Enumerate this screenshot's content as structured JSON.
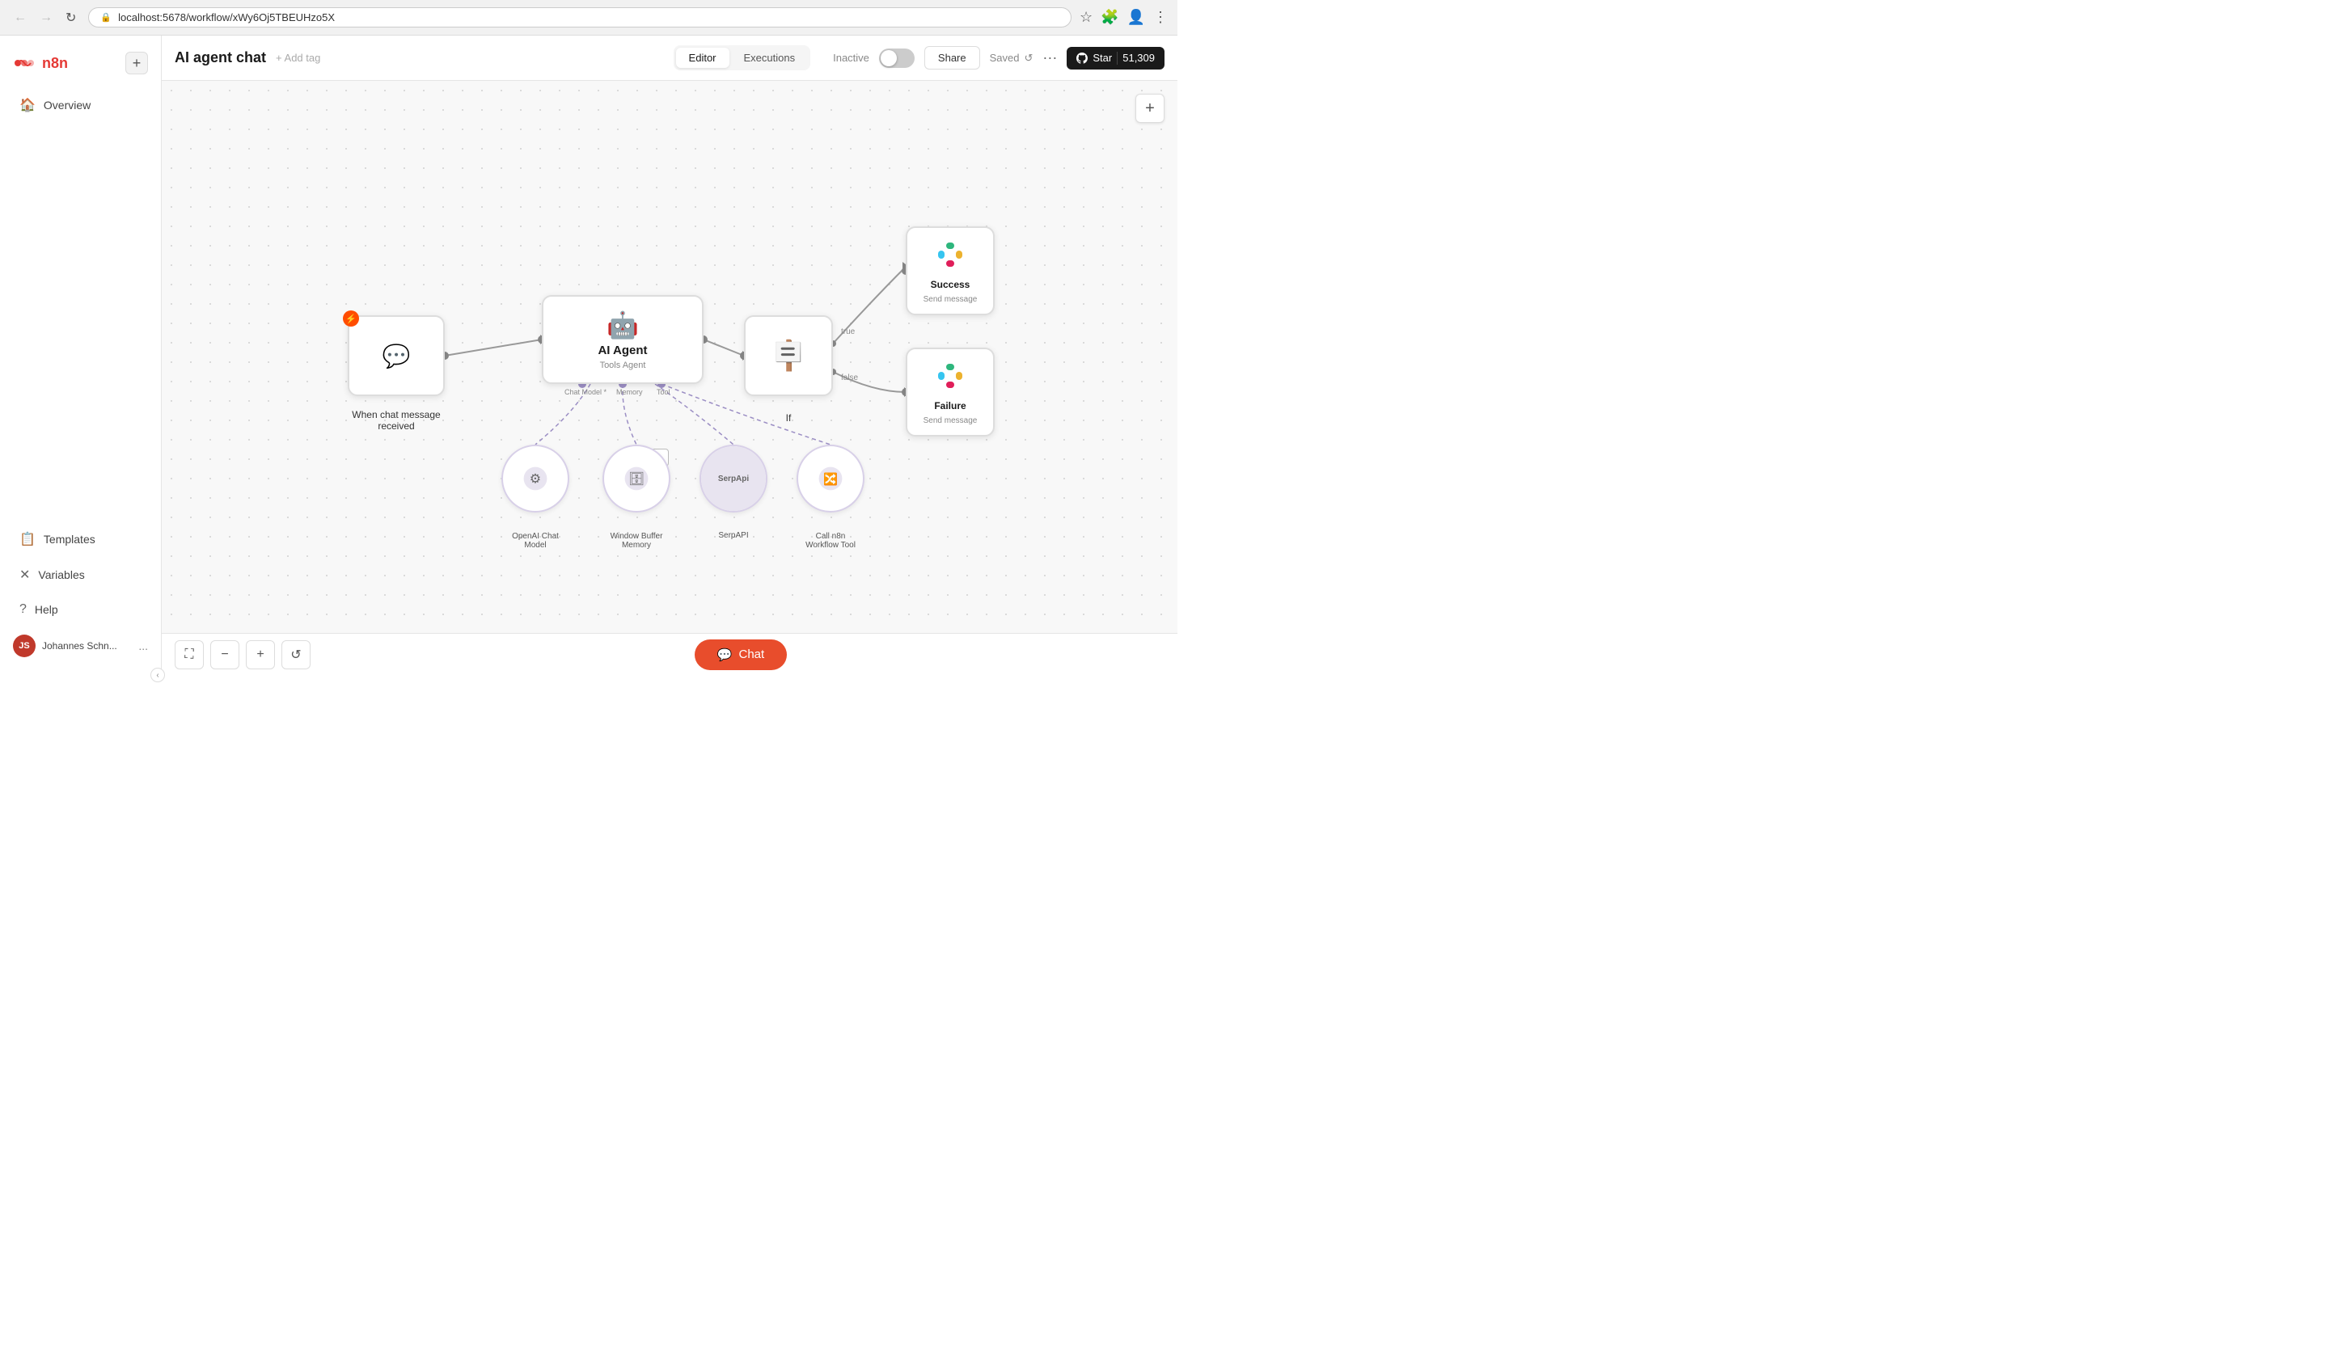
{
  "browser": {
    "url": "localhost:5678/workflow/xWy6Oj5TBEUHzo5X",
    "back_disabled": true,
    "forward_disabled": true
  },
  "sidebar": {
    "logo": "n8n",
    "add_label": "+",
    "items": [
      {
        "id": "overview",
        "icon": "🏠",
        "label": "Overview"
      },
      {
        "id": "templates",
        "icon": "📋",
        "label": "Templates"
      },
      {
        "id": "variables",
        "icon": "✕",
        "label": "Variables"
      },
      {
        "id": "help",
        "icon": "?",
        "label": "Help"
      }
    ],
    "user": {
      "initials": "JS",
      "name": "Johannes Schn...",
      "more": "..."
    }
  },
  "topbar": {
    "title": "AI agent chat",
    "add_tag": "+ Add tag",
    "status": "Inactive",
    "share_label": "Share",
    "saved_label": "Saved",
    "more": "···",
    "tabs": [
      {
        "id": "editor",
        "label": "Editor",
        "active": true
      },
      {
        "id": "executions",
        "label": "Executions",
        "active": false
      }
    ],
    "star_label": "Star",
    "star_count": "51,309"
  },
  "canvas": {
    "plus_label": "+"
  },
  "nodes": {
    "trigger": {
      "label_line1": "When chat message",
      "label_line2": "received"
    },
    "ai_agent": {
      "title": "AI Agent",
      "subtitle": "Tools Agent"
    },
    "if": {
      "label": "If"
    },
    "slack_success": {
      "title": "Success",
      "subtitle": "Send message"
    },
    "slack_failure": {
      "title": "Failure",
      "subtitle": "Send message"
    },
    "openai": {
      "label_line1": "OpenAI Chat",
      "label_line2": "Model"
    },
    "memory": {
      "label_line1": "Window Buffer",
      "label_line2": "Memory"
    },
    "serp": {
      "label": "SerpAPI"
    },
    "workflow_tool": {
      "label_line1": "Call n8n",
      "label_line2": "Workflow Tool"
    }
  },
  "ports": {
    "chat_model": "Chat Model *",
    "memory": "Memory",
    "tool": "Tool"
  },
  "edge_labels": {
    "true": "true",
    "false": "false"
  },
  "bottombar": {
    "chat_label": "Chat"
  }
}
